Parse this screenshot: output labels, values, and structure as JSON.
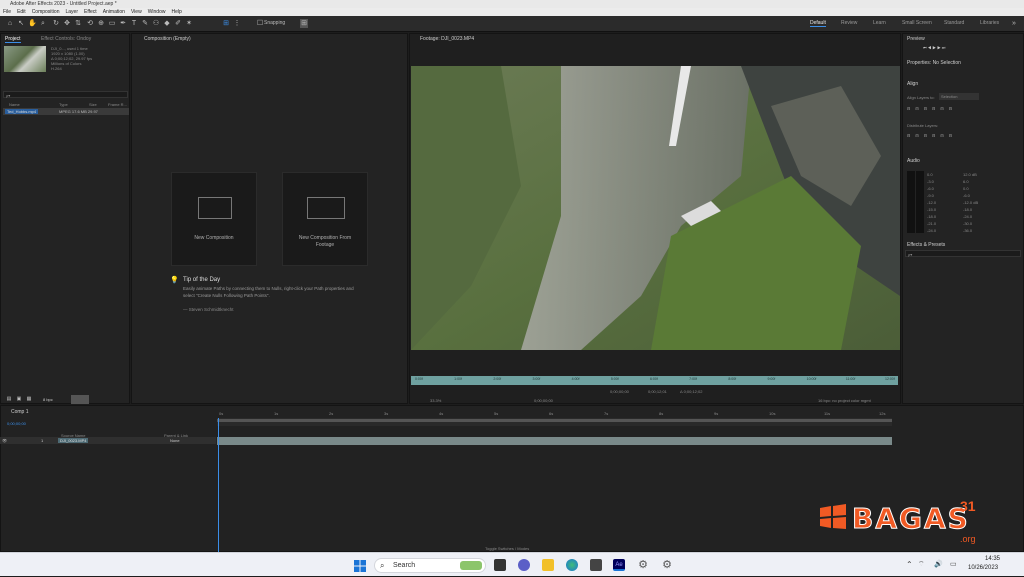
{
  "window": {
    "title": "Adobe After Effects 2023 - Untitled Project.aep *"
  },
  "menu": [
    "File",
    "Edit",
    "Composition",
    "Layer",
    "Effect",
    "Animation",
    "View",
    "Window",
    "Help"
  ],
  "toolbar": {
    "snapping_label": "Snapping"
  },
  "workspaces": [
    "Default",
    "Review",
    "Learn",
    "Small Screen",
    "Standard",
    "Libraries"
  ],
  "project_panel": {
    "tab_project": "Project",
    "tab_effect_controls": "Effect Controls: Ondoy",
    "file_info": [
      "DJI_0..., used 1 time",
      "1920 x 1080 (1.00)",
      "Δ 0;00;12;02, 29.97 fps",
      "Millions of Colors",
      "H.264"
    ],
    "search_placeholder": "ρ▾",
    "col_name": "Name",
    "col_type": "Type",
    "col_size": "Size",
    "col_frame_rate": "Frame R...",
    "item_name": "Ted_Hobbs.mp4",
    "item_meta": "MPEG  17.6 MB  29.97",
    "bpc": "8 bpc"
  },
  "composition_panel": {
    "tab": "Composition (Empty)",
    "new_composition": "New Composition",
    "new_from_footage": "New Composition From Footage",
    "tip_title": "Tip of the Day",
    "tip_body": "Easily animate Paths by connecting them to Nulls, right-click your Path properties and select \"Create Nulls Following Path Points\".",
    "tip_author": "— Steven Schmidtknecht"
  },
  "footage_panel": {
    "tab": "Footage: DJI_0023.MP4",
    "ruler_ticks": [
      "0:00f",
      "1:00f",
      "2:00f",
      "3:00f",
      "4:00f",
      "5:00f",
      "6:00f",
      "7:00f",
      "8:00f",
      "9:00f",
      "10:00f",
      "11:00f",
      "12:00f"
    ],
    "timecode_in": "0;00;00;00",
    "timecode_out": "0;00;12;01",
    "duration": "Δ 0;00;12;02",
    "zoom": "33.3%",
    "status": "16 bpc: no project color mgmt"
  },
  "right_panels": {
    "preview_title": "Preview",
    "properties_title": "Properties: No Selection",
    "align_title": "Align",
    "align_layers_to": "Align Layers to:",
    "align_selection": "Selection",
    "distribute_title": "Distribute Layers:",
    "audio_title": "Audio",
    "audio_levels_left": [
      "0.0",
      "-3.0",
      "-6.0",
      "-9.0",
      "-12.0",
      "-15.0",
      "-18.0",
      "-21.0",
      "-24.0"
    ],
    "audio_levels_right": [
      "12.0 dB",
      "6.0",
      "0.0",
      "-6.0",
      "-12.0 dB",
      "-18.0",
      "-24.0",
      "-30.0",
      "-36.0"
    ],
    "effects_title": "Effects & Presets",
    "effects_search": "ρ▾"
  },
  "timeline": {
    "tab": "Comp 1",
    "timecode": "0;00;00;00",
    "col_source": "Source Name",
    "col_parent": "Parent & Link",
    "layer_number": "1",
    "layer_name": "DJI_0023.MP4",
    "layer_parent": "None",
    "footer_label": "Toggle Switches / Modes",
    "ruler_ticks": [
      "0s",
      "1s",
      "2s",
      "3s",
      "4s",
      "5s",
      "6s",
      "7s",
      "8s",
      "9s",
      "10s",
      "11s",
      "12s"
    ]
  },
  "taskbar": {
    "search_label": "Search",
    "time": "14:35",
    "date": "10/26/2023"
  },
  "watermark": {
    "brand": "BAGAS",
    "number": "31",
    "domain": ".org"
  },
  "colors": {
    "accent": "#3b8ee8",
    "ruler": "#6fa1a0",
    "brand_orange": "#f15a24"
  }
}
